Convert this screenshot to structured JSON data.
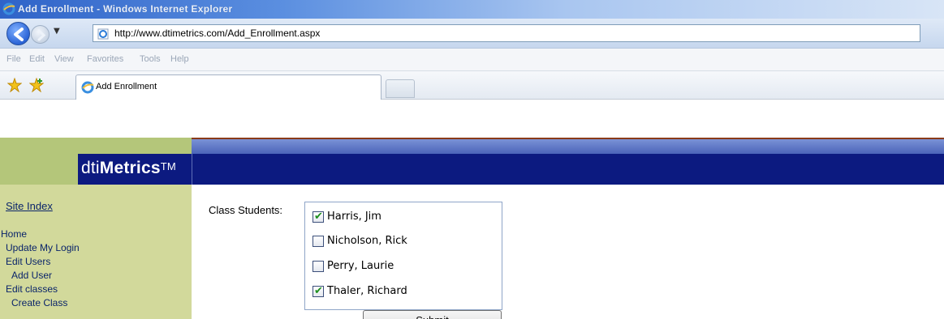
{
  "window": {
    "title": "Add Enrollment - Windows Internet Explorer"
  },
  "address_bar": {
    "url": "http://www.dtimetrics.com/Add_Enrollment.aspx"
  },
  "menu": [
    "File",
    "Edit",
    "View",
    "Favorites",
    "Tools",
    "Help"
  ],
  "tab": {
    "label": "Add Enrollment"
  },
  "logo": {
    "prefix": "dti",
    "bold": "Metrics",
    "tm": "TM"
  },
  "sidebar": {
    "site_index": "Site Index",
    "items": [
      {
        "label": "Home"
      },
      {
        "label": "Update My Login"
      },
      {
        "label": "Edit Users"
      },
      {
        "label": "Add User"
      },
      {
        "label": "Edit classes"
      },
      {
        "label": "Create Class"
      }
    ]
  },
  "form": {
    "class_students_label": "Class Students:",
    "students": [
      {
        "name": "Harris, Jim",
        "checked": true
      },
      {
        "name": "Nicholson, Rick",
        "checked": false
      },
      {
        "name": "Perry, Laurie",
        "checked": false
      },
      {
        "name": "Thaler, Richard",
        "checked": true
      }
    ],
    "submit_label": "Submit"
  }
}
